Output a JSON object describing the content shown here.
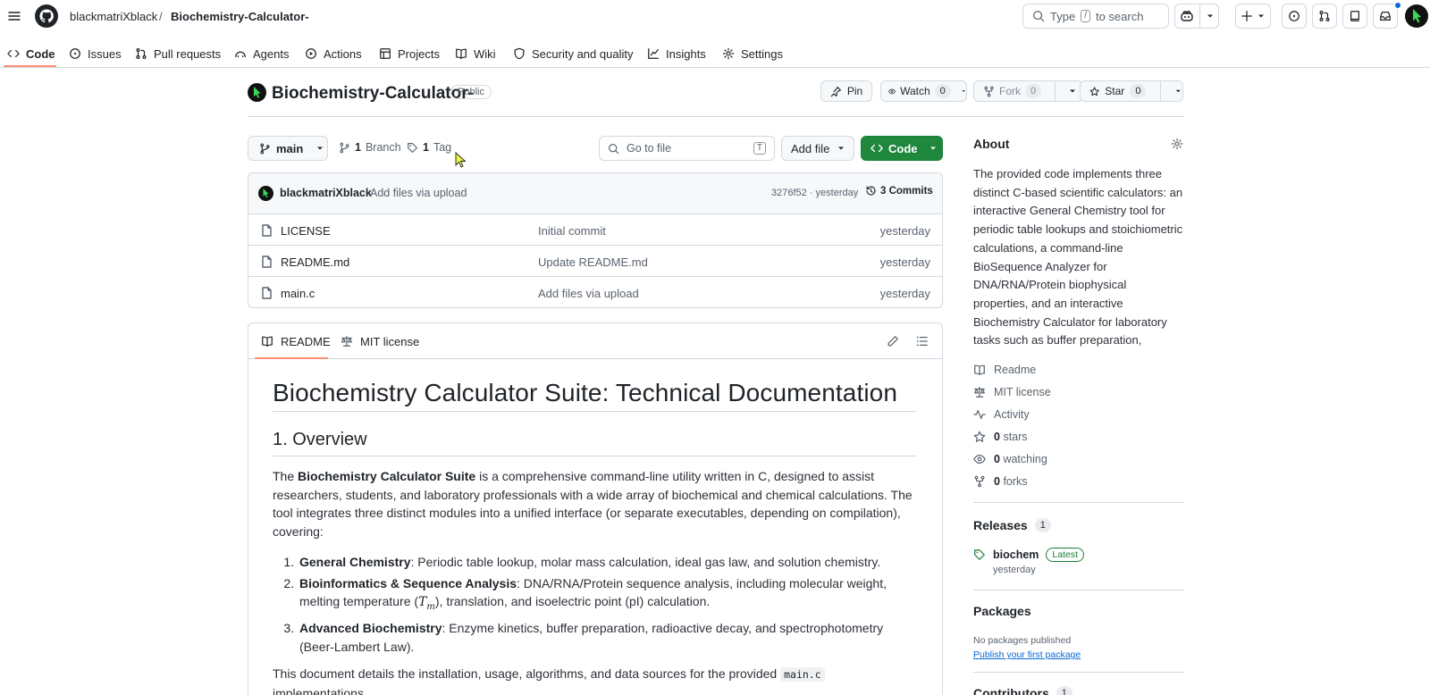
{
  "header": {
    "owner": "blackmatriXblack",
    "separator": "/",
    "repo": "Biochemistry-Calculator-",
    "search_prefix": "Type",
    "search_key": "/",
    "search_suffix": "to search"
  },
  "nav": {
    "tabs": [
      {
        "label": "Code",
        "icon": "code-icon"
      },
      {
        "label": "Issues",
        "icon": "issue-icon"
      },
      {
        "label": "Pull requests",
        "icon": "pull-request-icon"
      },
      {
        "label": "Agents",
        "icon": "agents-icon"
      },
      {
        "label": "Actions",
        "icon": "play-icon"
      },
      {
        "label": "Projects",
        "icon": "table-icon"
      },
      {
        "label": "Wiki",
        "icon": "book-icon"
      },
      {
        "label": "Security and quality",
        "icon": "shield-icon"
      },
      {
        "label": "Insights",
        "icon": "graph-icon"
      },
      {
        "label": "Settings",
        "icon": "gear-icon"
      }
    ]
  },
  "repo": {
    "name": "Biochemistry-Calculator-",
    "visibility": "Public",
    "pin_label": "Pin",
    "watch_label": "Watch",
    "watch_count": "0",
    "fork_label": "Fork",
    "fork_count": "0",
    "star_label": "Star",
    "star_count": "0"
  },
  "toolbar": {
    "branch": "main",
    "branch_count": "1",
    "branch_label": "Branch",
    "tag_count": "1",
    "tag_label": "Tag",
    "goto_placeholder": "Go to file",
    "goto_key": "T",
    "add_file_label": "Add file",
    "code_label": "Code"
  },
  "commit": {
    "author": "blackmatriXblack",
    "message": "Add files via upload",
    "hash_time": "3276f52 · yesterday",
    "commits_label": "3 Commits"
  },
  "files": [
    {
      "name": "LICENSE",
      "message": "Initial commit",
      "time": "yesterday"
    },
    {
      "name": "README.md",
      "message": "Update README.md",
      "time": "yesterday"
    },
    {
      "name": "main.c",
      "message": "Add files via upload",
      "time": "yesterday"
    }
  ],
  "readme": {
    "tab_readme": "README",
    "tab_license": "MIT license",
    "h1": "Biochemistry Calculator Suite: Technical Documentation",
    "h2": "1. Overview",
    "intro_the": "The",
    "intro_bold": "Biochemistry Calculator Suite",
    "intro_rest": "is a comprehensive command-line utility written in C, designed to assist researchers, students, and laboratory professionals with a wide array of biochemical and chemical calculations. The tool integrates three distinct modules into a unified interface (or separate executables, depending on compilation), covering:",
    "items": [
      {
        "bold": "General Chemistry",
        "text": ": Periodic table lookup, molar mass calculation, ideal gas law, and solution chemistry."
      },
      {
        "bold": "Bioinformatics & Sequence Analysis",
        "text_a": ": DNA/RNA/Protein sequence analysis, including molecular weight, melting temperature (",
        "math": "T",
        "sub": "m",
        "text_b": "), translation, and isoelectric point (pI) calculation."
      },
      {
        "bold": "Advanced Biochemistry",
        "text": ": Enzyme kinetics, buffer preparation, radioactive decay, and spectrophotometry (Beer-Lambert Law)."
      }
    ],
    "final_a": "This document details the installation, usage, algorithms, and data sources for the provided",
    "final_code": "main.c",
    "final_b": "implementations."
  },
  "about": {
    "title": "About",
    "description": "The provided code implements three distinct C-based scientific calculators: an interactive General Chemistry tool for periodic table lookups and stoichiometric calculations, a command-line BioSequence Analyzer for DNA/RNA/Protein biophysical properties, and an interactive Biochemistry Calculator for laboratory tasks such as buffer preparation,",
    "readme": "Readme",
    "license": "MIT license",
    "activity": "Activity",
    "stars_count": "0",
    "stars_label": "stars",
    "watching_count": "0",
    "watching_label": "watching",
    "forks_count": "0",
    "forks_label": "forks"
  },
  "releases": {
    "title": "Releases",
    "count": "1",
    "tag": "biochem",
    "badge": "Latest",
    "time": "yesterday"
  },
  "packages": {
    "title": "Packages",
    "none": "No packages published",
    "link": "Publish your first package"
  },
  "contributors": {
    "title": "Contributors",
    "count": "1"
  },
  "colors": {
    "accent_green": "#1f883d",
    "link_blue": "#0969da",
    "tab_underline": "#fd8c73",
    "cursor_yellow": "#e9f542"
  }
}
